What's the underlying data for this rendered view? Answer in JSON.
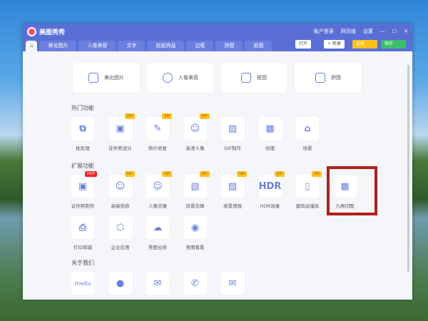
{
  "app": {
    "title": "美图秀秀",
    "account": "账户登录",
    "web": "网页版",
    "settings": "设置"
  },
  "tabs": [
    "美化图片",
    "人像美容",
    "文字",
    "贴纸饰品",
    "边框",
    "拼图",
    "抠图"
  ],
  "toolbar": {
    "open": "打开",
    "new": "+ 新建",
    "vip": "会员",
    "save": "保存"
  },
  "cards": [
    "美化图片",
    "人像美容",
    "抠图",
    "拼图"
  ],
  "sections": {
    "hot": "热门功能",
    "ext": "扩展功能",
    "about": "关于我们"
  },
  "hot": [
    {
      "label": "批处理",
      "icon": "⧉"
    },
    {
      "label": "证件照设计",
      "icon": "▣",
      "badge": "VIP"
    },
    {
      "label": "照片修复",
      "icon": "✎",
      "badge": "VIP"
    },
    {
      "label": "高清人像",
      "icon": "☺",
      "badge": "VIP"
    },
    {
      "label": "GIF制作",
      "icon": "▨"
    },
    {
      "label": "纹理",
      "icon": "▩"
    },
    {
      "label": "场景",
      "icon": "⌂"
    }
  ],
  "ext": [
    {
      "label": "证件照制作",
      "icon": "▣",
      "badge": "HOT"
    },
    {
      "label": "高级祛痘",
      "icon": "☺",
      "badge": "VIP"
    },
    {
      "label": "人像去噪",
      "icon": "☺",
      "badge": "VIP"
    },
    {
      "label": "风景去噪",
      "icon": "▧",
      "badge": "VIP"
    },
    {
      "label": "夜景增强",
      "icon": "▨",
      "badge": "VIP"
    },
    {
      "label": "HDR效果",
      "icon": "HDR",
      "badge": "VIP"
    },
    {
      "label": "建筑动漫风",
      "icon": "▯",
      "badge": "VIP"
    },
    {
      "label": "九格切图",
      "icon": "▦"
    }
  ],
  "ext2": [
    {
      "label": "打印商城",
      "icon": "⎙"
    },
    {
      "label": "企业应用",
      "icon": "⬡"
    },
    {
      "label": "美图云修",
      "icon": "☁"
    },
    {
      "label": "美图看看",
      "icon": "◉"
    }
  ],
  "about": [
    {
      "icon": "meitu"
    },
    {
      "icon": "●"
    },
    {
      "icon": "✉"
    },
    {
      "icon": "✆"
    },
    {
      "icon": "✉"
    }
  ]
}
